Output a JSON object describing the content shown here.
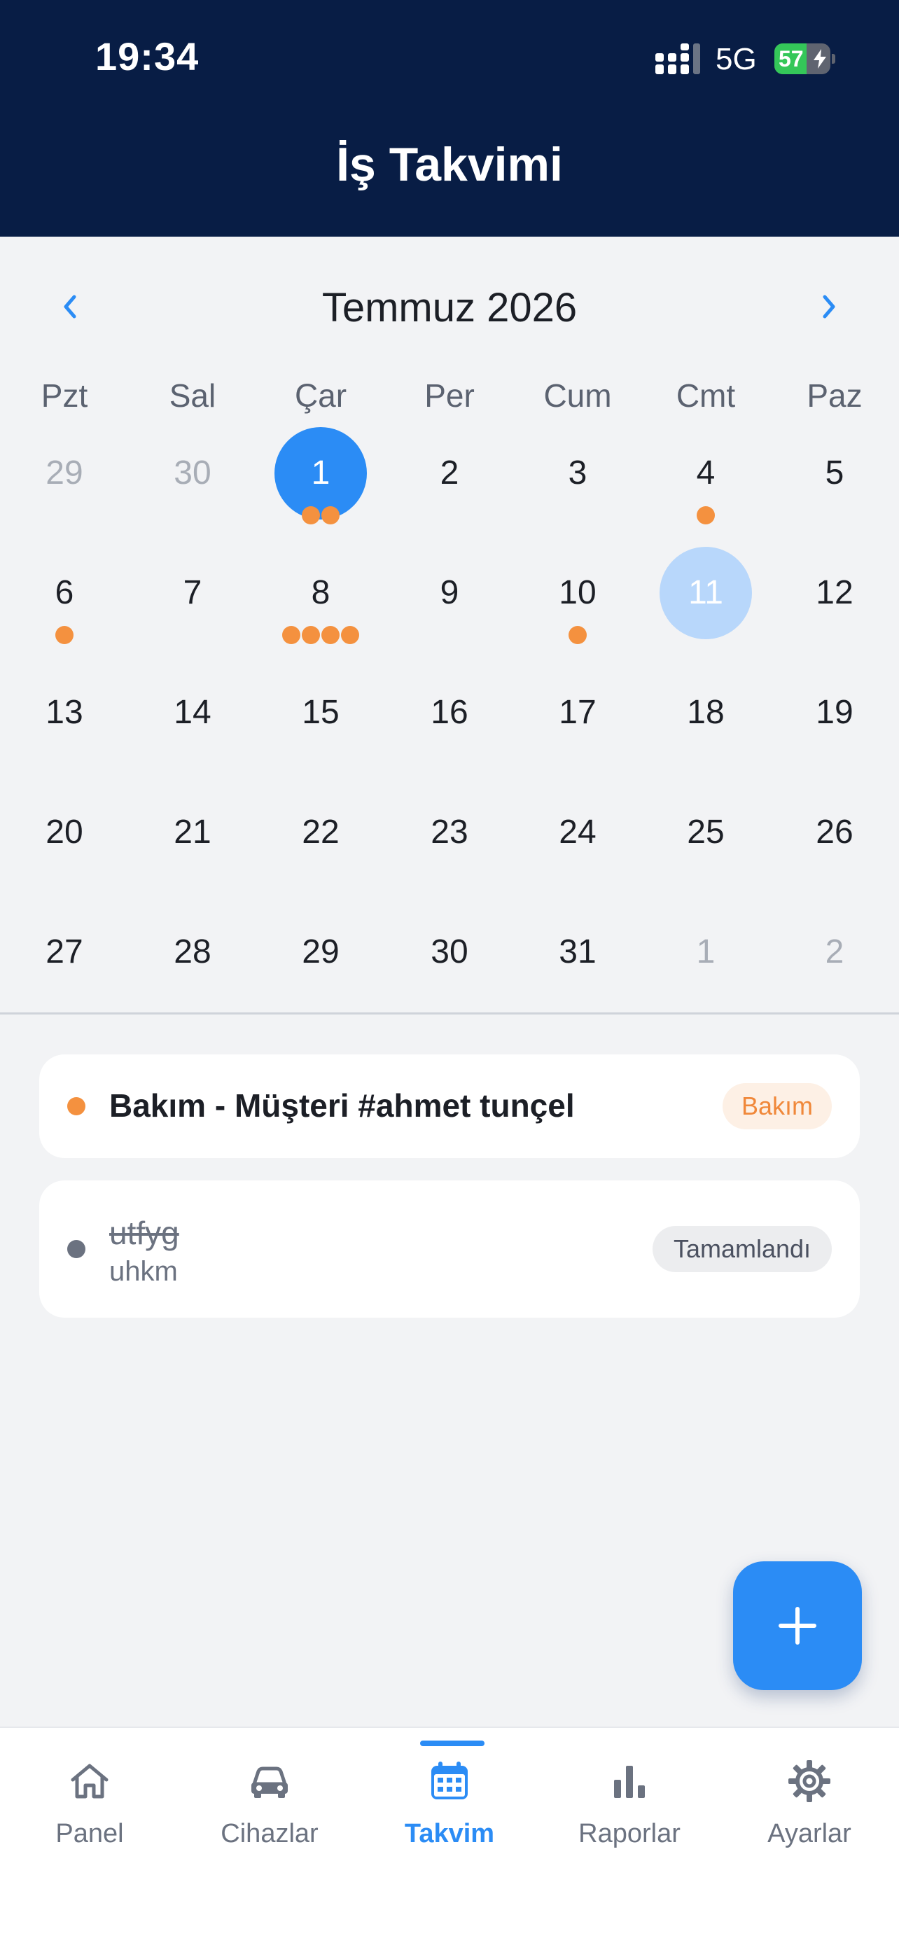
{
  "status_bar": {
    "time": "19:34",
    "network": "5G",
    "battery": "57",
    "battery_fraction": 0.57
  },
  "header": {
    "title": "İş Takvimi"
  },
  "calendar": {
    "month_label": "Temmuz 2026",
    "weekdays": [
      "Pzt",
      "Sal",
      "Çar",
      "Per",
      "Cum",
      "Cmt",
      "Paz"
    ],
    "weeks": [
      [
        {
          "d": "29",
          "muted": true,
          "dots": 0
        },
        {
          "d": "30",
          "muted": true,
          "dots": 0
        },
        {
          "d": "1",
          "selected": true,
          "dots": 2
        },
        {
          "d": "2",
          "dots": 0
        },
        {
          "d": "3",
          "dots": 0
        },
        {
          "d": "4",
          "dots": 1
        },
        {
          "d": "5",
          "dots": 0
        }
      ],
      [
        {
          "d": "6",
          "dots": 1
        },
        {
          "d": "7",
          "dots": 0
        },
        {
          "d": "8",
          "dots": 4
        },
        {
          "d": "9",
          "dots": 0
        },
        {
          "d": "10",
          "dots": 1
        },
        {
          "d": "11",
          "today": true,
          "dots": 0
        },
        {
          "d": "12",
          "dots": 0
        }
      ],
      [
        {
          "d": "13",
          "dots": 0
        },
        {
          "d": "14",
          "dots": 0
        },
        {
          "d": "15",
          "dots": 0
        },
        {
          "d": "16",
          "dots": 0
        },
        {
          "d": "17",
          "dots": 0
        },
        {
          "d": "18",
          "dots": 0
        },
        {
          "d": "19",
          "dots": 0
        }
      ],
      [
        {
          "d": "20",
          "dots": 0
        },
        {
          "d": "21",
          "dots": 0
        },
        {
          "d": "22",
          "dots": 0
        },
        {
          "d": "23",
          "dots": 0
        },
        {
          "d": "24",
          "dots": 0
        },
        {
          "d": "25",
          "dots": 0
        },
        {
          "d": "26",
          "dots": 0
        }
      ],
      [
        {
          "d": "27",
          "dots": 0
        },
        {
          "d": "28",
          "dots": 0
        },
        {
          "d": "29",
          "dots": 0
        },
        {
          "d": "30",
          "dots": 0
        },
        {
          "d": "31",
          "dots": 0
        },
        {
          "d": "1",
          "muted": true,
          "dots": 0
        },
        {
          "d": "2",
          "muted": true,
          "dots": 0
        }
      ]
    ]
  },
  "events": [
    {
      "title": "Bakım - Müşteri #ahmet tunçel",
      "badge": "Bakım",
      "status_color": "#f4913f"
    },
    {
      "title": "utfyg",
      "subtitle": "uhkm",
      "badge": "Tamamlandı",
      "status_color": "#6b7280",
      "completed": true
    }
  ],
  "fab": {
    "icon": "plus-icon"
  },
  "tabbar": {
    "active": "Takvim",
    "items": [
      {
        "label": "Panel",
        "icon": "home-icon"
      },
      {
        "label": "Cihazlar",
        "icon": "car-icon"
      },
      {
        "label": "Takvim",
        "icon": "calendar-icon"
      },
      {
        "label": "Raporlar",
        "icon": "bar-chart-icon"
      },
      {
        "label": "Ayarlar",
        "icon": "gear-icon"
      }
    ]
  },
  "colors": {
    "accent": "#2b8cf5",
    "header_bg": "#081d45",
    "event_orange": "#f4913f",
    "today_bg": "#b8d7fb"
  }
}
